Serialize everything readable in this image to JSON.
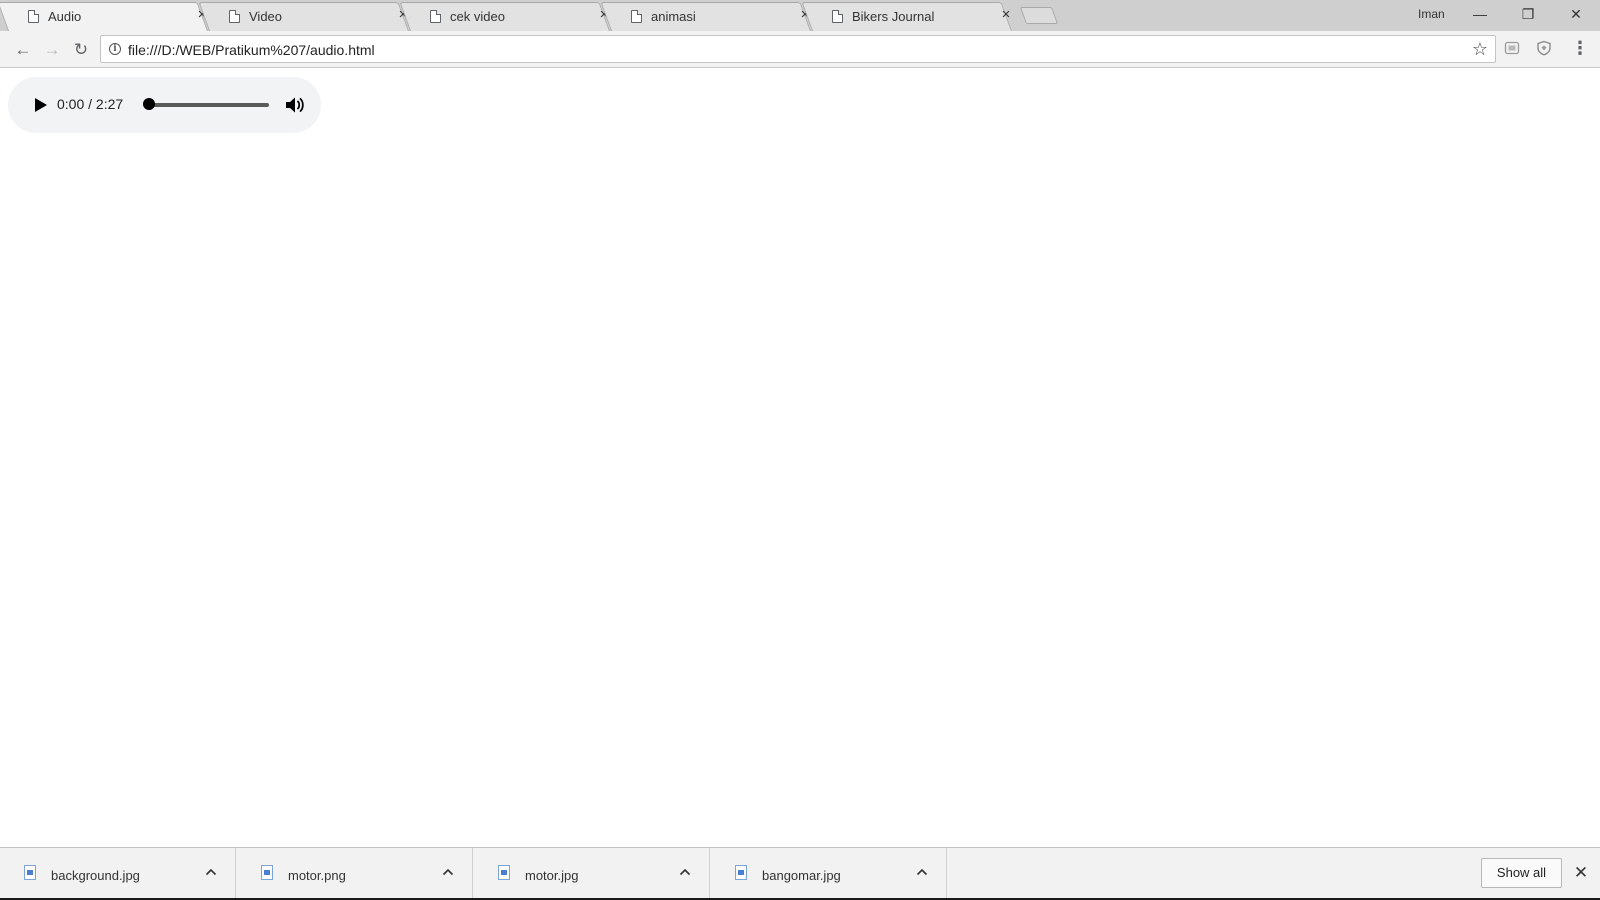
{
  "tabs": [
    {
      "title": "Audio",
      "active": true
    },
    {
      "title": "Video",
      "active": false
    },
    {
      "title": "cek video",
      "active": false
    },
    {
      "title": "animasi",
      "active": false
    },
    {
      "title": "Bikers Journal",
      "active": false
    }
  ],
  "icons": {
    "tab_close": "×",
    "window_minimize": "—",
    "window_restore": "❐",
    "window_close": "✕",
    "back": "←",
    "forward": "→",
    "reload": "↻",
    "info": "i",
    "star": "☆",
    "menu": "⋮",
    "shelf_close": "✕"
  },
  "profile": {
    "name": "Iman"
  },
  "address_bar": {
    "url": "file:///D:/WEB/Pratikum%207/audio.html"
  },
  "audio_player": {
    "time_display": "0:00 / 2:27",
    "progress_fraction": 0
  },
  "downloads": [
    {
      "filename": "background.jpg"
    },
    {
      "filename": "motor.png"
    },
    {
      "filename": "motor.jpg"
    },
    {
      "filename": "bangomar.jpg"
    }
  ],
  "download_shelf": {
    "show_all_label": "Show all"
  },
  "colors": {
    "accent": "#4a7fd0",
    "player_bg": "#f1f3f4"
  }
}
